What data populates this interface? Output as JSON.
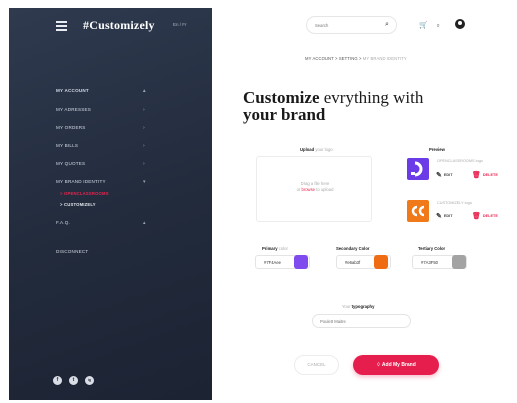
{
  "colors": {
    "accent": "#e61e4d",
    "sidebar": "#252e40"
  },
  "sidebar": {
    "brand": "#Customizely",
    "lang": "En / Fr",
    "nav": [
      {
        "label": "MY ACCOUNT"
      },
      {
        "label": "MY ADRESSES"
      },
      {
        "label": "MY ORDERS"
      },
      {
        "label": "MY BILLS"
      },
      {
        "label": "MY QUOTES"
      },
      {
        "label": "MY BRAND IDENTITY"
      }
    ],
    "brand_sub": [
      {
        "label": "> OPENCLASSROOMS"
      },
      {
        "label": "> CUSTOMIZELY"
      }
    ],
    "faq": "F.A.Q.",
    "disconnect": "DISCONNECT",
    "socials": [
      "f",
      "t",
      "ig"
    ]
  },
  "topbar": {
    "search_placeholder": "Search",
    "cart_count": "0"
  },
  "breadcrumb": {
    "home": "MY ACCOUNT",
    "sep": ">",
    "setting": "SETTING",
    "current": "MY BRAND IDENTITY"
  },
  "title": {
    "strong": "Customize",
    "rest": " evrything with",
    "line2": "your brand"
  },
  "upload": {
    "label": "Upload",
    "label_hint": "your logo",
    "drop_text": "Drag a file here",
    "or": "or",
    "browse": "browse",
    "upload_suffix": "to upload"
  },
  "preview": {
    "label": "Preview",
    "items": [
      {
        "name": "OPENCLASSROOMS logo",
        "edit": "EDIT",
        "delete": "DELETE",
        "color": "#6c3be8"
      },
      {
        "name": "CUSTOMIZELY logo",
        "edit": "EDIT",
        "delete": "DELETE",
        "color": "#f07a1a"
      }
    ]
  },
  "palette": {
    "primary": {
      "label": "Primary",
      "hint": "color",
      "hex": "#7F4Aee",
      "color": "#7f4aee"
    },
    "secondary": {
      "label": "Secondary Color",
      "hex": "#e6ab3f",
      "color": "#ef6c12"
    },
    "tertiary": {
      "label": "Tertiary Color",
      "hex": "#7A3F50",
      "color": "#a3a3a3"
    }
  },
  "typography": {
    "label_hint": "Your",
    "label": "typography",
    "value": "Poulett Maitre"
  },
  "buttons": {
    "cancel": "CANCEL",
    "add": "Add My Brand"
  }
}
